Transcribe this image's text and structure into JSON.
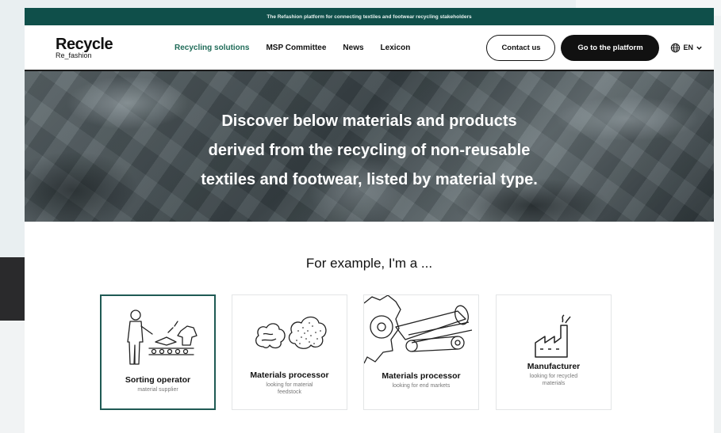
{
  "announcement": "The Refashion platform for connecting textiles and footwear recycling stakeholders",
  "logo": {
    "main": "Recycle",
    "sub": "Re_fashion"
  },
  "nav": {
    "items": [
      {
        "label": "Recycling solutions",
        "active": true
      },
      {
        "label": "MSP Committee",
        "active": false
      },
      {
        "label": "News",
        "active": false
      },
      {
        "label": "Lexicon",
        "active": false
      }
    ],
    "contact_label": "Contact us",
    "platform_label": "Go to the platform",
    "language": "EN"
  },
  "hero": {
    "line1": "Discover below materials and products",
    "line2": "derived from the recycling of non-reusable",
    "line3": "textiles and footwear, listed by material type."
  },
  "example_heading": "For example, I'm a ...",
  "cards": [
    {
      "title": "Sorting operator",
      "subtitle_lines": [
        "material supplier"
      ],
      "icon": "sorting-operator-icon",
      "selected": true
    },
    {
      "title": "Materials processor",
      "subtitle_lines": [
        "looking for material",
        "feedstock"
      ],
      "icon": "material-fibers-icon",
      "selected": false
    },
    {
      "title": "Materials processor",
      "subtitle_lines": [
        "looking for end markets"
      ],
      "icon": "fabric-rolls-icon",
      "selected": false
    },
    {
      "title": "Manufacturer",
      "subtitle_lines": [
        "looking for recycled",
        "materials"
      ],
      "icon": "factory-icon",
      "selected": false
    }
  ],
  "colors": {
    "announcement_bg": "#0f4f4a",
    "active_nav": "#1f6b58",
    "selected_card_border": "#1f5a54"
  }
}
